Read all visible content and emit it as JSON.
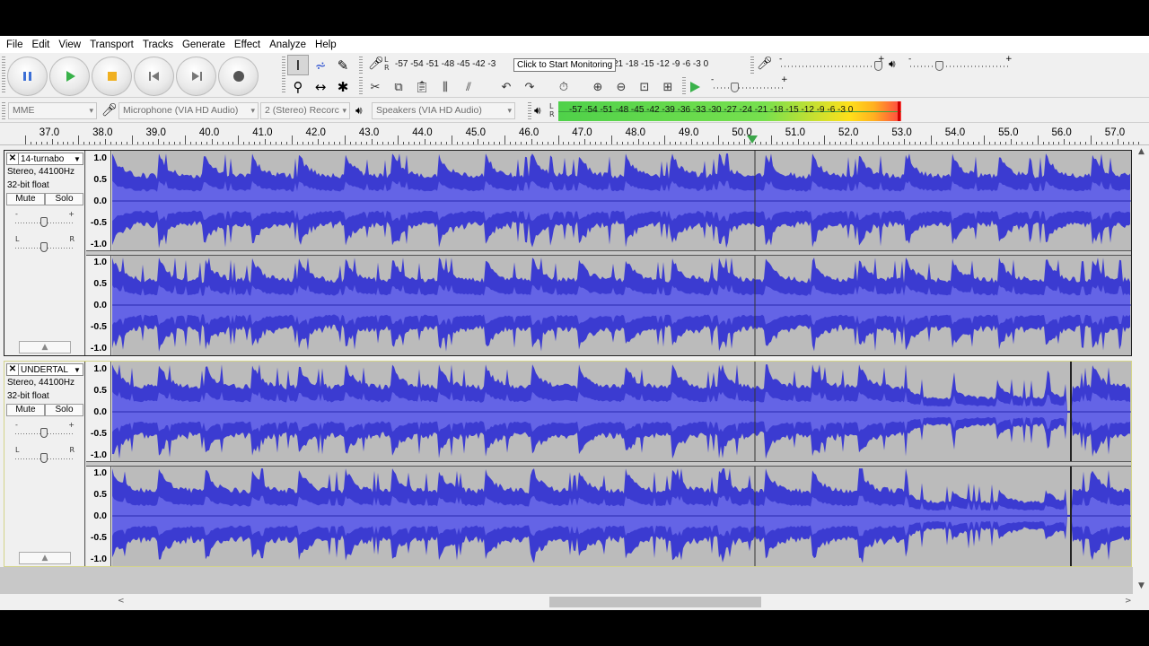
{
  "menu": [
    {
      "label": "File",
      "u": "F",
      "rest": "ile"
    },
    {
      "label": "Edit",
      "u": "E",
      "rest": "dit"
    },
    {
      "label": "View",
      "u": "V",
      "rest": "iew"
    },
    {
      "label": "Transport",
      "u": "T",
      "rest": "ransport"
    },
    {
      "label": "Tracks",
      "u": "T",
      "rest": "racks"
    },
    {
      "label": "Generate",
      "u": "G",
      "rest": "enerate"
    },
    {
      "label": "Effect",
      "u": "c",
      "pre": "Effe",
      "rest": "t"
    },
    {
      "label": "Analyze",
      "u": "A",
      "rest": "nalyze"
    },
    {
      "label": "Help",
      "u": "H",
      "rest": "elp"
    }
  ],
  "meters": {
    "record_scale": "-57 -54 -51 -48 -45 -42 -3",
    "record_scale_tail": "21 -18 -15 -12  -9  -6  -3  0",
    "tooltip": "Click to Start Monitoring",
    "playback_scale": "-57 -54 -51 -48 -45 -42 -39 -36 -33 -30 -27 -24 -21 -18 -15 -12  -9  -6  -3  0",
    "lr_left": "L",
    "lr_right": "R",
    "minus": "-",
    "plus": "+"
  },
  "devices": {
    "host": "MME",
    "input": "Microphone (VIA HD Audio)",
    "channels": "2 (Stereo) Recorc",
    "output": "Speakers (VIA HD Audio)"
  },
  "ruler": {
    "labels": [
      "37.0",
      "38.0",
      "39.0",
      "40.0",
      "41.0",
      "42.0",
      "43.0",
      "44.0",
      "45.0",
      "46.0",
      "47.0",
      "48.0",
      "49.0",
      "50.0",
      "51.0",
      "52.0",
      "53.0",
      "54.0",
      "55.0",
      "56.0",
      "57.0"
    ]
  },
  "tracks": [
    {
      "name": "14-turnabo",
      "info1": "Stereo, 44100Hz",
      "info2": "32-bit float",
      "mute": "Mute",
      "solo": "Solo",
      "selected": false
    },
    {
      "name": "UNDERTAL",
      "info1": "Stereo, 44100Hz",
      "info2": "32-bit float",
      "mute": "Mute",
      "solo": "Solo",
      "selected": true
    }
  ],
  "vruler": [
    "1.0",
    "0.5",
    "0.0",
    "-0.5",
    "-1.0"
  ],
  "track_slider": {
    "gain_minus": "-",
    "gain_plus": "+",
    "pan_left": "L",
    "pan_right": "R"
  },
  "colors": {
    "waveform": "#3b3bd1",
    "waveform_rms": "#6464e6",
    "wave_bg": "#bbbbbb",
    "meter_green": "#4fd14a",
    "play_green": "#3ca64a",
    "record_red": "#a33",
    "pause_blue": "#3c6fd6",
    "stop_yellow": "#f0b020"
  },
  "icons": {
    "pause": "pause-icon",
    "play": "play-icon",
    "stop": "stop-icon",
    "skip_start": "skip-to-start-icon",
    "skip_end": "skip-to-end-icon",
    "record": "record-icon"
  }
}
